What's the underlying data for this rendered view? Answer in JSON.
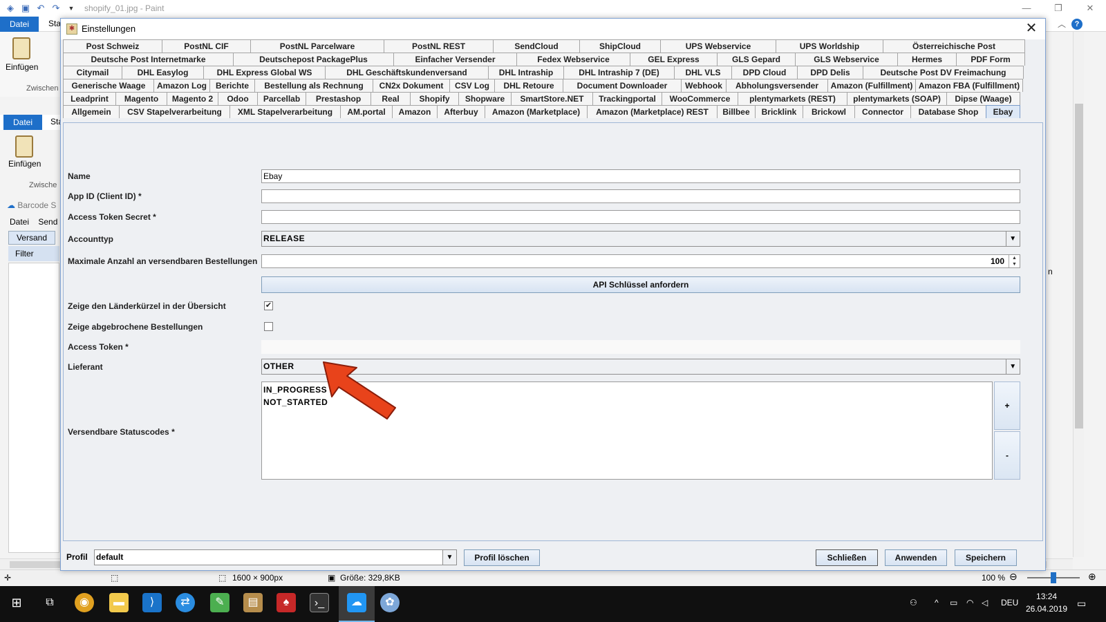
{
  "paint": {
    "title": "shopify_01.jpg - Paint",
    "datei": "Datei",
    "start": "Sta",
    "einfuegen": "Einfügen",
    "zwischen": "Zwischen",
    "datei2": "Datei",
    "start2": "Sta",
    "einfuegen2": "Einfügen",
    "zwischen2": "Zwische"
  },
  "barcode": {
    "title": "Barcode S",
    "menu_datei": "Datei",
    "menu_send": "Send",
    "tab_versand": "Versand",
    "filter": "Filter",
    "col_right": "n"
  },
  "statusbar": {
    "dimensions": "1600 × 900px",
    "size": "Größe: 329,8KB",
    "zoom": "100 %"
  },
  "taskbar": {
    "lang": "DEU",
    "time": "13:24",
    "date": "26.04.2019"
  },
  "dialog": {
    "title": "Einstellungen",
    "tab_rows": [
      [
        "Post Schweiz",
        "PostNL CIF",
        "PostNL Parcelware",
        "PostNL REST",
        "SendCloud",
        "ShipCloud",
        "UPS Webservice",
        "UPS Worldship",
        "Österreichische Post"
      ],
      [
        "Deutsche Post Internetmarke",
        "Deutschepost PackagePlus",
        "Einfacher Versender",
        "Fedex Webservice",
        "GEL Express",
        "GLS Gepard",
        "GLS Webservice",
        "Hermes",
        "PDF Form"
      ],
      [
        "Citymail",
        "DHL Easylog",
        "DHL Express Global WS",
        "DHL Geschäftskundenversand",
        "DHL Intraship",
        "DHL Intraship 7 (DE)",
        "DHL VLS",
        "DPD Cloud",
        "DPD Delis",
        "Deutsche Post DV Freimachung"
      ],
      [
        "Generische Waage",
        "Amazon Log",
        "Berichte",
        "Bestellung als Rechnung",
        "CN2x Dokument",
        "CSV Log",
        "DHL Retoure",
        "Document Downloader",
        "Webhook",
        "Abholungsversender",
        "Amazon (Fulfillment)",
        "Amazon FBA (Fulfillment)"
      ],
      [
        "Leadprint",
        "Magento",
        "Magento 2",
        "Odoo",
        "Parcellab",
        "Prestashop",
        "Real",
        "Shopify",
        "Shopware",
        "SmartStore.NET",
        "Trackingportal",
        "WooCommerce",
        "plentymarkets (REST)",
        "plentymarkets (SOAP)",
        "Dipse (Waage)"
      ],
      [
        "Allgemein",
        "CSV Stapelverarbeitung",
        "XML Stapelverarbeitung",
        "AM.portal",
        "Amazon",
        "Afterbuy",
        "Amazon (Marketplace)",
        "Amazon (Marketplace) REST",
        "Billbee",
        "Bricklink",
        "Brickowl",
        "Connector",
        "Database Shop",
        "Ebay"
      ]
    ],
    "form": {
      "name_label": "Name",
      "name_value": "Ebay",
      "appid_label": "App ID (Client ID) *",
      "appid_value": "",
      "secret_label": "Access Token Secret *",
      "secret_value": "",
      "accounttyp_label": "Accounttyp",
      "accounttyp_value": "RELEASE",
      "max_label": "Maximale Anzahl an versendbaren Bestellungen",
      "max_value": "100",
      "api_button": "API Schlüssel anfordern",
      "country_label": "Zeige den Länderkürzel in der Übersicht",
      "country_checked": true,
      "cancelled_label": "Zeige abgebrochene Bestellungen",
      "cancelled_checked": false,
      "token_label": "Access Token *",
      "token_value": "",
      "lieferant_label": "Lieferant",
      "lieferant_value": "OTHER",
      "status_label": "Versendbare Statuscodes *",
      "status_items": [
        "IN_PROGRESS",
        "NOT_STARTED"
      ],
      "add_btn": "+",
      "remove_btn": "-"
    },
    "bottom": {
      "profil_label": "Profil",
      "profil_value": "default",
      "delete_btn": "Profil löschen",
      "close_btn": "Schließen",
      "apply_btn": "Anwenden",
      "save_btn": "Speichern"
    }
  },
  "colors": {
    "accent": "#1e6fc9",
    "arrow": "#e8431b",
    "active_tab": "#dde8f6"
  }
}
